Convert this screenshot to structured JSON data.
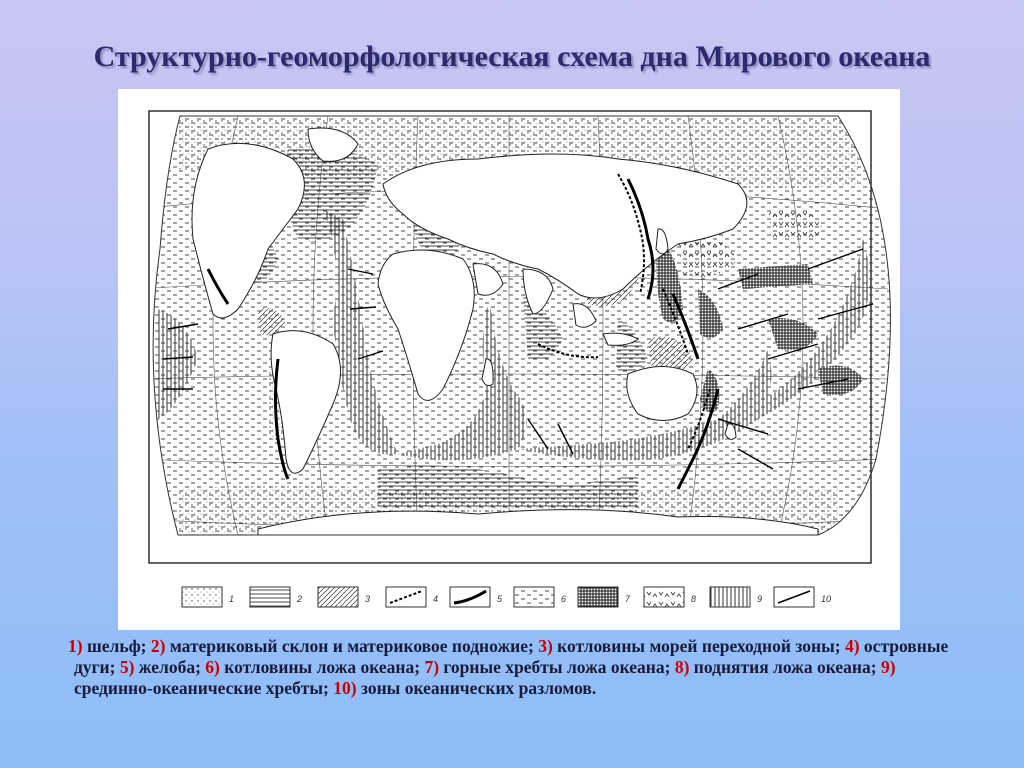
{
  "slide": {
    "title": "Структурно-геоморфологическая схема дна Мирового океана"
  },
  "legend": {
    "items": [
      {
        "num": "1",
        "pattern": "dots"
      },
      {
        "num": "2",
        "pattern": "hlines"
      },
      {
        "num": "3",
        "pattern": "diag"
      },
      {
        "num": "4",
        "pattern": "dashed-line"
      },
      {
        "num": "5",
        "pattern": "thick-curve"
      },
      {
        "num": "6",
        "pattern": "dashes"
      },
      {
        "num": "7",
        "pattern": "crosshatch"
      },
      {
        "num": "8",
        "pattern": "checks"
      },
      {
        "num": "9",
        "pattern": "vlines"
      },
      {
        "num": "10",
        "pattern": "fault-line"
      }
    ]
  },
  "caption": {
    "n1": "1)",
    "t1": " шельф; ",
    "n2": "2)",
    "t2": " материковый склон и материковое подножие; ",
    "n3": "3)",
    "t3": " котловины морей переходной зоны; ",
    "n4": "4)",
    "t4": " островные дуги; ",
    "n5": "5)",
    "t5": " желоба; ",
    "n6": "6)",
    "t6": " котловины ложа океана; ",
    "n7": "7)",
    "t7": " горные хребты ложа океана; ",
    "n8": "8)",
    "t8": " поднятия ложа океана; ",
    "n9": "9)",
    "t9": " срединно-океанические хребты; ",
    "n10": "10)",
    "t10": " зоны океанических разломов."
  },
  "colors": {
    "title": "#2a2a6e",
    "number_accent": "#cc0000",
    "caption_text": "#1a1a3a"
  }
}
